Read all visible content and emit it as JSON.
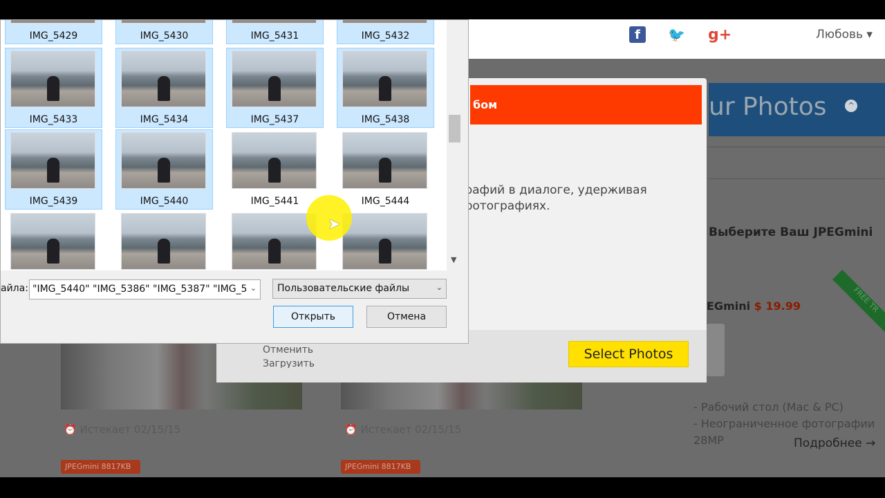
{
  "header": {
    "social": [
      {
        "icon": "facebook-icon",
        "glyph": "f",
        "color": "#3b5998"
      },
      {
        "icon": "twitter-icon",
        "glyph": "🐦",
        "color": "#1da1f2"
      },
      {
        "icon": "google-plus-icon",
        "glyph": "g+",
        "color": "#dd4b39"
      }
    ],
    "user": "Любовь ▾"
  },
  "background": {
    "banner_title": "ur Photos",
    "banner_toggle": "^",
    "choose_text": "Выберите Ваш JPEGmini",
    "product": "EGmini",
    "price": "$ 19.99",
    "ribbon": "FREE TR",
    "features": [
      "- Рабочий стол (Mac & PC)",
      "- Неограниченное фотографии",
      "28MP"
    ],
    "more_link": "Подробнее →",
    "cards": [
      {
        "expires": "Истекает 02/15/15",
        "badge_brand": "JPEGmini",
        "badge_size": "8817KB"
      },
      {
        "expires": "Истекает 02/15/15",
        "badge_brand": "JPEGmini",
        "badge_size": "8817KB"
      }
    ]
  },
  "modal": {
    "title": "бом",
    "text_lines": [
      "ографий в диалоге, удерживая",
      "а фотографиях."
    ],
    "cancel_link": "Отменить",
    "upload_link": "Загрузить",
    "select_button": "Select Photos",
    "accent": "#ff3a00"
  },
  "file_dialog": {
    "files": [
      {
        "name": "IMG_5429",
        "selected": true
      },
      {
        "name": "IMG_5430",
        "selected": true
      },
      {
        "name": "IMG_5431",
        "selected": true
      },
      {
        "name": "IMG_5432",
        "selected": true
      },
      {
        "name": "IMG_5433",
        "selected": true
      },
      {
        "name": "IMG_5434",
        "selected": true
      },
      {
        "name": "IMG_5437",
        "selected": true
      },
      {
        "name": "IMG_5438",
        "selected": true
      },
      {
        "name": "IMG_5439",
        "selected": true
      },
      {
        "name": "IMG_5440",
        "selected": true
      },
      {
        "name": "IMG_5441",
        "selected": false
      },
      {
        "name": "IMG_5444",
        "selected": false
      },
      {
        "name": "",
        "selected": false
      },
      {
        "name": "",
        "selected": false
      },
      {
        "name": "",
        "selected": false
      },
      {
        "name": "",
        "selected": false
      }
    ],
    "filename_label": "айла:",
    "filename_value": "\"IMG_5440\" \"IMG_5386\" \"IMG_5387\" \"IMG_5",
    "filetype": "Пользовательские файлы",
    "open_button": "Открыть",
    "cancel_button": "Отмена"
  }
}
